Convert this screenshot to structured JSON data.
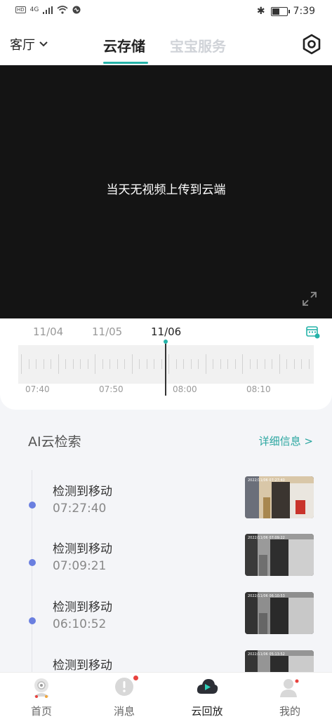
{
  "status_bar": {
    "network": "4G",
    "time": "7:39",
    "battery_level": 0.55
  },
  "header": {
    "room": "客厅",
    "tabs": [
      {
        "label": "云存储",
        "active": true
      },
      {
        "label": "宝宝服务",
        "active": false
      }
    ]
  },
  "video": {
    "message": "当天无视频上传到云端"
  },
  "timeline": {
    "dates": [
      "11/04",
      "11/05",
      "11/06"
    ],
    "selected_date": "11/06",
    "times": [
      "07:40",
      "07:50",
      "08:00",
      "08:10"
    ]
  },
  "ai_search": {
    "title": "AI云检索",
    "more_label": "详细信息 >",
    "events": [
      {
        "title": "检测到移动",
        "time": "07:27:40",
        "stamp": "2022/11/06 07:27:40"
      },
      {
        "title": "检测到移动",
        "time": "07:09:21",
        "stamp": "2022/11/06 07:09:22"
      },
      {
        "title": "检测到移动",
        "time": "06:10:52",
        "stamp": "2022/11/06 06:10:53"
      },
      {
        "title": "检测到移动",
        "time": "",
        "stamp": "2022/11/06 05:13:52"
      }
    ]
  },
  "bottom_nav": [
    {
      "label": "首页",
      "icon": "home-robot-icon",
      "active": false
    },
    {
      "label": "消息",
      "icon": "message-icon",
      "active": false,
      "badge": true
    },
    {
      "label": "云回放",
      "icon": "cloud-playback-icon",
      "active": true
    },
    {
      "label": "我的",
      "icon": "profile-icon",
      "active": false
    }
  ],
  "colors": {
    "accent": "#25b3a9",
    "event_dot": "#6a7fe0",
    "badge": "#e8423e"
  }
}
